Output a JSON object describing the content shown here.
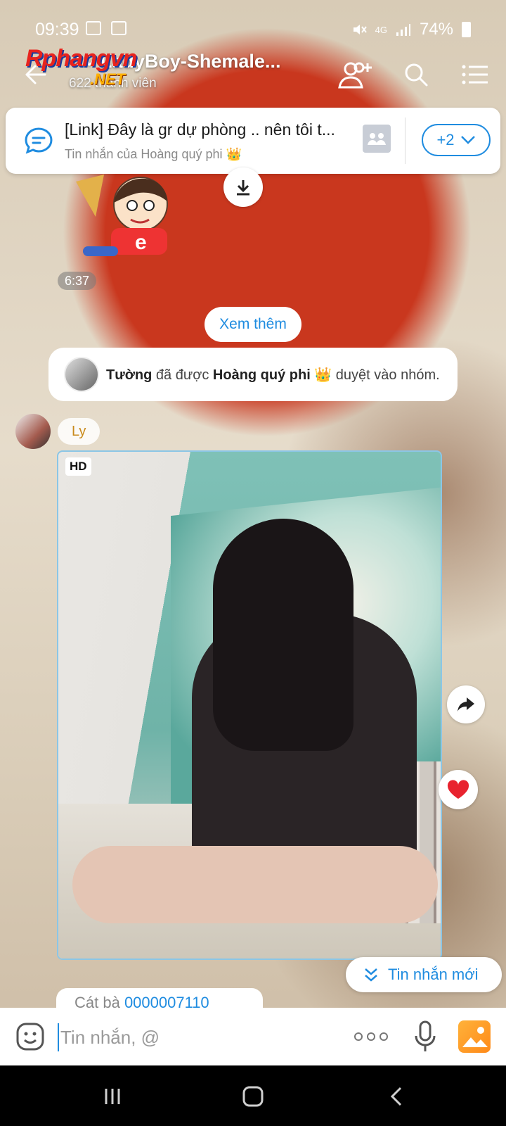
{
  "status_bar": {
    "time": "09:39",
    "network": "4G",
    "battery": "74%"
  },
  "header": {
    "watermark": "Rphangvn",
    "watermark_sub": ".NET",
    "group_title": "♀✓LadyBoy-Shemale...",
    "members": "622 thành viên"
  },
  "pinned": {
    "title": "[Link] Đây là gr dự phòng .. nên tôi t...",
    "subtitle": "Tin nhắn của Hoàng quý phi 👑",
    "more_label": "+2"
  },
  "chat": {
    "sticker_time": "6:37",
    "see_more": "Xem thêm",
    "system_user": "Tường",
    "system_mid": " đã được ",
    "system_admin": "Hoàng quý phi 👑",
    "system_end": " duyệt vào nhóm.",
    "sender_name": "Ly",
    "photo_badge": "HD",
    "new_messages": "Tin nhắn mới",
    "partial_text": "Cát bà ",
    "partial_number": "0000007110"
  },
  "composer": {
    "placeholder": "Tin nhắn, @"
  },
  "colors": {
    "accent": "#1f8ce0",
    "like": "#e8232f",
    "sender_name": "#c98a1b"
  }
}
